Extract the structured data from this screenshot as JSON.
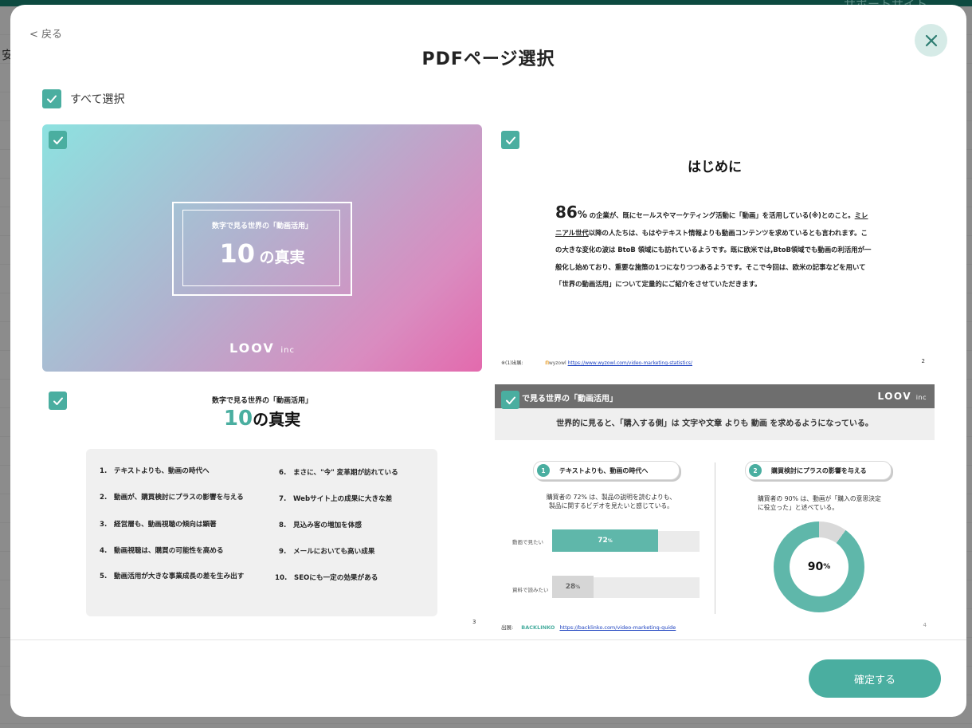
{
  "backdrop": {
    "top_link": "サポートサイト",
    "left_char": "安"
  },
  "modal": {
    "back_label": "< 戻る",
    "title": "PDFページ選択",
    "select_all_label": "すべて選択",
    "confirm_label": "確定する",
    "accent_color": "#4aaea0"
  },
  "pages": {
    "p1": {
      "selected": true,
      "subtitle": "数字で見る世界の「動画活用」",
      "title_num": "10",
      "title_text": "の真実",
      "logo": "LOOV",
      "logo_suffix": "inc"
    },
    "p2": {
      "selected": true,
      "title": "はじめに",
      "pct": "86",
      "pct_unit": "%",
      "body_1": "の企業が、既にセールスやマーケティング活動に「動画」を活用している(※)とのこと。",
      "body_link": "ミレニアル世代",
      "body_2": "以降の人たちは、もはやテキスト情報よりも動画コンテンツを求めているとも言われます。この大きな変化の波は BtoB 領域にも訪れているようです。既に欧米では,BtoB領域でも動画の利活用が一般化し始めており、重要な施策の1つになりつつあるようです。そこで今回は、欧米の記事などを用いて「世界の動画活用」について定量的にご紹介をさせていただきます。",
      "footnote": "※(1)出展:",
      "source_brand": "wyzowl",
      "source_url": "https://www.wyzowl.com/video-marketing-statistics/",
      "page_num": "2"
    },
    "p3": {
      "selected": true,
      "subtitle": "数字で見る世界の「動画活用」",
      "title_num": "10",
      "title_text": "の真実",
      "items": [
        {
          "n": "1.",
          "text": "テキストよりも、動画の時代へ"
        },
        {
          "n": "2.",
          "text": "動画が、購買検討にプラスの影響を与える"
        },
        {
          "n": "3.",
          "text": "経営層も、動画視聴の傾向は顕著"
        },
        {
          "n": "4.",
          "text": "動画視聴は、購買の可能性を高める"
        },
        {
          "n": "5.",
          "text": "動画活用が大きな事業成長の差を生み出す"
        },
        {
          "n": "6.",
          "text": "まさに、\"今\" 変革期が訪れている"
        },
        {
          "n": "7.",
          "text": "Webサイト上の成果に大きな差"
        },
        {
          "n": "8.",
          "text": "見込み客の増加を体感"
        },
        {
          "n": "9.",
          "text": "メールにおいても高い成果"
        },
        {
          "n": "10.",
          "text": "SEOにも一定の効果がある"
        }
      ],
      "page_num": "3"
    },
    "p4": {
      "selected": true,
      "header_title": "で見る世界の「動画活用」",
      "logo": "LOOV",
      "logo_suffix": "inc",
      "band_text": "世界的に見ると、「購入する側」は 文字や文章 よりも 動画 を求めるようになっている。",
      "left_pill_num": "1",
      "left_pill_text": "テキストよりも、動画の時代へ",
      "left_caption_1": "購買者の 72% は、製品の説明を読むよりも、",
      "left_caption_2": "製品に関するビデオを見たいと感じている。",
      "bars": [
        {
          "label": "動画で見たい",
          "value": 72,
          "text": "72",
          "unit": "%",
          "color": "#5fb7aa"
        },
        {
          "label": "資料で読みたい",
          "value": 28,
          "text": "28",
          "unit": "%",
          "color": "#d6d6d6"
        }
      ],
      "right_pill_num": "2",
      "right_pill_text": "購買検討にプラスの影響を与える",
      "right_caption_1": "購買者の 90% は、動画が「購入の意思決定",
      "right_caption_2": "に役立った」と述べている。",
      "donut_value": 90,
      "donut_text": "90",
      "donut_unit": "%",
      "donut_color": "#5fb7aa",
      "donut_rest_color": "#d9d9d9",
      "source_label": "出展:",
      "source_brand": "BACKLINKO",
      "source_url": "https://backlinko.com/video-marketing-guide",
      "page_num": "4"
    }
  }
}
